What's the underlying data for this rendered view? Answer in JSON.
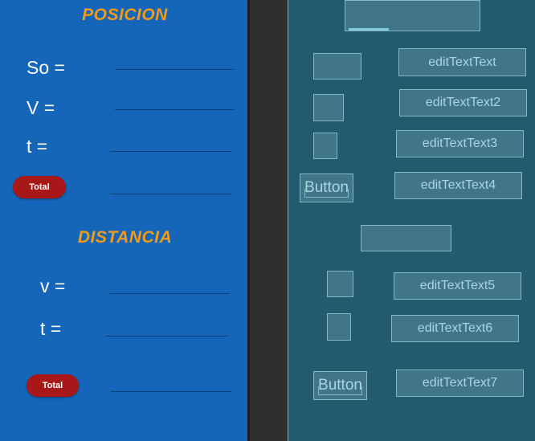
{
  "design": {
    "posicion_title": "POSICION",
    "so_label": "So =",
    "v_label": "V =",
    "t_label": "t =",
    "total_button_1": "Total",
    "distancia_title": "DISTANCIA",
    "v2_label": "v =",
    "t2_label": "t =",
    "total_button_2": "Total"
  },
  "blueprint": {
    "edit1": "editTextText",
    "edit2": "editTextText2",
    "edit3": "editTextText3",
    "button1": "Button",
    "edit4": "editTextText4",
    "edit5": "editTextText5",
    "edit6": "editTextText6",
    "button2": "Button",
    "edit7": "editTextText7"
  },
  "colors": {
    "design_bg": "#1565b8",
    "title": "#f59b16",
    "button": "#a91818",
    "blueprint_bg": "#245a6e"
  }
}
